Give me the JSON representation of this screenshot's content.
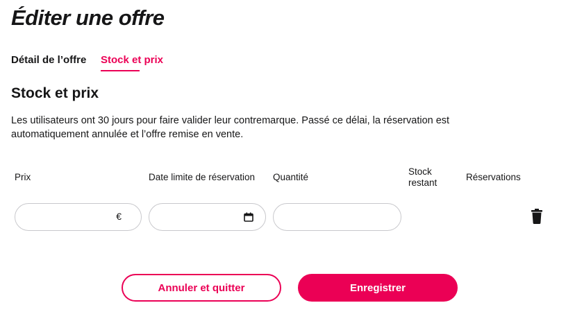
{
  "header": {
    "title": "Éditer une offre"
  },
  "tabs": [
    {
      "label": "Détail de l’offre",
      "active": false
    },
    {
      "label": "Stock et prix",
      "active": true
    }
  ],
  "section": {
    "title": "Stock et prix",
    "description": "Les utilisateurs ont 30 jours pour faire valider leur contremarque. Passé ce délai, la réservation est automatiquement annulée et l’offre remise en vente."
  },
  "table": {
    "columns": {
      "prix": "Prix",
      "date_limite": "Date limite de réservation",
      "quantite": "Quantité",
      "stock_line1": "Stock",
      "stock_line2": "restant",
      "reservations": "Réservations"
    },
    "row": {
      "prix_value": "",
      "prix_suffix": "€",
      "date_value": "",
      "quantite_value": ""
    }
  },
  "actions": {
    "cancel_label": "Annuler et quitter",
    "save_label": "Enregistrer"
  },
  "icons": {
    "calendar": "calendar-icon",
    "trash": "trash-icon"
  },
  "colors": {
    "accent": "#eb0055",
    "text": "#161617",
    "border": "#c8c8cc"
  }
}
